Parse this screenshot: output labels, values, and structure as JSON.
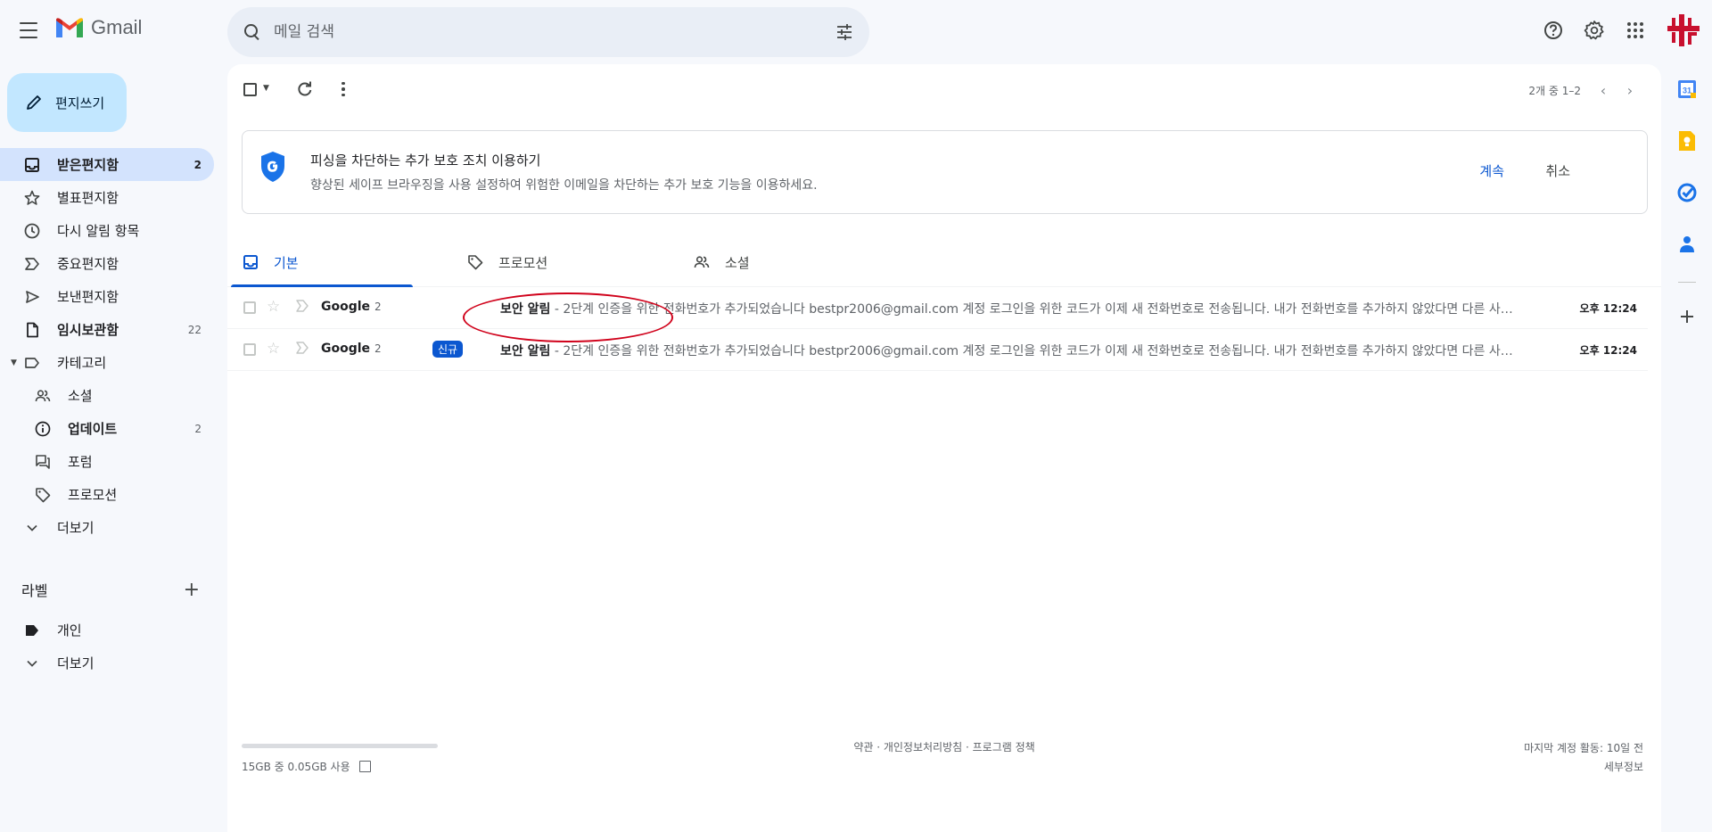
{
  "app": {
    "name": "Gmail"
  },
  "search": {
    "placeholder": "메일 검색",
    "value": ""
  },
  "compose": {
    "label": "편지쓰기"
  },
  "sidebar": {
    "items": [
      {
        "label": "받은편지함",
        "count": "2"
      },
      {
        "label": "별표편지함",
        "count": ""
      },
      {
        "label": "다시 알림 항목",
        "count": ""
      },
      {
        "label": "중요편지함",
        "count": ""
      },
      {
        "label": "보낸편지함",
        "count": ""
      },
      {
        "label": "임시보관함",
        "count": "22"
      },
      {
        "label": "카테고리",
        "count": ""
      },
      {
        "label": "소셜",
        "count": ""
      },
      {
        "label": "업데이트",
        "count": "2"
      },
      {
        "label": "포럼",
        "count": ""
      },
      {
        "label": "프로모션",
        "count": ""
      },
      {
        "label": "더보기",
        "count": ""
      }
    ],
    "labels_title": "라벨",
    "labels": [
      {
        "label": "개인"
      },
      {
        "label": "더보기"
      }
    ]
  },
  "toolbar": {
    "pager": "2개 중 1–2"
  },
  "banner": {
    "title": "피싱을 차단하는 추가 보호 조치 이용하기",
    "subtitle": "향상된 세이프 브라우징을 사용 설정하여 위험한 이메일을 차단하는 추가 보호 기능을 이용하세요.",
    "continue_label": "계속",
    "cancel_label": "취소"
  },
  "tabs": [
    {
      "label": "기본"
    },
    {
      "label": "프로모션"
    },
    {
      "label": "소셜"
    }
  ],
  "emails": [
    {
      "sender": "Google",
      "count": "2",
      "badge": "",
      "subject": "보안 알림",
      "snippet": " - 2단계 인증을 위한 전화번호가 추가되었습니다 bestpr2006@gmail.com 계정 로그인을 위한 코드가 이제 새 전화번호로 전송됩니다. 내가 전화번호를 추가하지 않았다면 다른 사용자가 내 계정을 사용하고 있을 수 있습니다.",
      "time": "오후 12:24"
    },
    {
      "sender": "Google",
      "count": "2",
      "badge": "신규",
      "subject": "보안 알림",
      "snippet": " - 2단계 인증을 위한 전화번호가 추가되었습니다 bestpr2006@gmail.com 계정 로그인을 위한 코드가 이제 새 전화번호로 전송됩니다. 내가 전화번호를 추가하지 않았다면 다른 사용자가 내 계정을 사용하고 있을 수 있습니다.",
      "time": "오후 12:24"
    }
  ],
  "footer": {
    "storage": "15GB 중 0.05GB 사용",
    "storage_used_fraction": 0.0033,
    "links": "약관 · 개인정보처리방침 · 프로그램 정책",
    "last_activity": "마지막 계정 활동: 10일 전",
    "details": "세부정보"
  },
  "colors": {
    "accent": "#0b57d0",
    "compose_bg": "#c2e7ff",
    "active_nav_bg": "#d3e3fd",
    "annotation": "#d0021b"
  },
  "icons": {
    "top_right": [
      "help-icon",
      "settings-icon",
      "apps-grid-icon"
    ],
    "side_panel": [
      "calendar-icon",
      "keep-icon",
      "tasks-icon",
      "contacts-icon",
      "add-addon-icon"
    ]
  }
}
